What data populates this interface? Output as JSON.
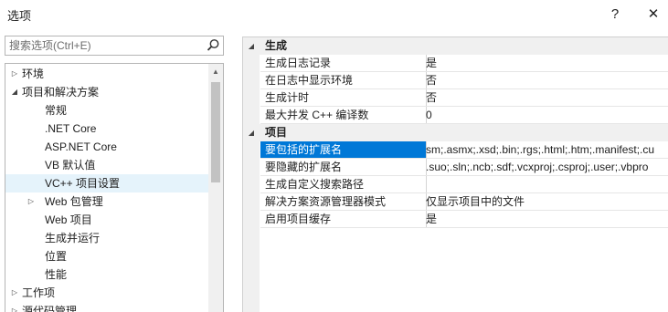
{
  "window": {
    "title": "选项",
    "help_label": "?",
    "close_label": "✕"
  },
  "search": {
    "placeholder": "搜索选项(Ctrl+E)"
  },
  "tree": [
    {
      "label": "环境",
      "arrow": "▷"
    },
    {
      "label": "项目和解决方案",
      "arrow": "◢"
    },
    {
      "label": "常规",
      "arrow": ""
    },
    {
      "label": ".NET Core",
      "arrow": ""
    },
    {
      "label": "ASP.NET Core",
      "arrow": ""
    },
    {
      "label": "VB 默认值",
      "arrow": ""
    },
    {
      "label": "VC++ 项目设置",
      "arrow": "",
      "selected": true
    },
    {
      "label": "Web 包管理",
      "arrow": "▷"
    },
    {
      "label": "Web 项目",
      "arrow": ""
    },
    {
      "label": "生成并运行",
      "arrow": ""
    },
    {
      "label": "位置",
      "arrow": ""
    },
    {
      "label": "性能",
      "arrow": ""
    },
    {
      "label": "工作项",
      "arrow": "▷"
    },
    {
      "label": "源代码管理",
      "arrow": "▷"
    }
  ],
  "grid": {
    "categories": [
      {
        "label": "生成",
        "toggle": "◢"
      },
      {
        "label": "项目",
        "toggle": "◢"
      }
    ],
    "build_rows": [
      {
        "name": "生成日志记录",
        "value": "是"
      },
      {
        "name": "在日志中显示环境",
        "value": "否"
      },
      {
        "name": "生成计时",
        "value": "否"
      },
      {
        "name": "最大并发 C++ 编译数",
        "value": "0"
      }
    ],
    "project_rows": [
      {
        "name": "要包括的扩展名",
        "value": "sm;.asmx;.xsd;.bin;.rgs;.html;.htm;.manifest;.cu"
      },
      {
        "name": "要隐藏的扩展名",
        "value": ".suo;.sln;.ncb;.sdf;.vcxproj;.csproj;.user;.vbpro"
      },
      {
        "name": "生成自定义搜索路径",
        "value": ""
      },
      {
        "name": "解决方案资源管理器模式",
        "value": "仅显示项目中的文件"
      },
      {
        "name": "启用项目缓存",
        "value": "是"
      }
    ]
  },
  "colors": {
    "selection": "#0078d7",
    "tree_selection": "#e5f3fb",
    "gutter": "#f0f0f0"
  },
  "icons": {
    "search": "search-icon"
  }
}
